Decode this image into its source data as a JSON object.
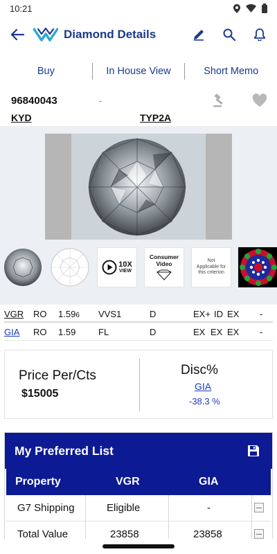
{
  "status": {
    "time": "10:21"
  },
  "app": {
    "title": "Diamond Details",
    "brand_color": "#1a3a8c"
  },
  "tabs": [
    {
      "label": "Buy"
    },
    {
      "label": "In House View"
    },
    {
      "label": "Short Memo"
    }
  ],
  "stone": {
    "stock_no": "96840043",
    "dash": "-",
    "code_left": "KYD",
    "code_right": "TYP2A"
  },
  "thumbs": {
    "consumer_video": "Consumer Video",
    "ten_x": "10X",
    "view": "VIEW",
    "not_applicable": "Not Applicable for this criterion"
  },
  "grading": [
    {
      "lab": "VGR",
      "shape": "RO",
      "carat": "1.59",
      "carat_suffix": "6",
      "clarity": "VVS1",
      "color": "D",
      "cut": "EX+",
      "polish": "ID",
      "symmetry": "EX",
      "fluor": "-"
    },
    {
      "lab": "GIA",
      "shape": "RO",
      "carat": "1.59",
      "carat_suffix": "",
      "clarity": "FL",
      "color": "D",
      "cut": "EX",
      "polish": "EX",
      "symmetry": "EX",
      "fluor": "-"
    }
  ],
  "price": {
    "label": "Price Per/Cts",
    "value": "$15005",
    "disc_label": "Disc%",
    "disc_lab": "GIA",
    "disc_value": "-38.3 %"
  },
  "preferred": {
    "title": "My Preferred List",
    "header_color": "#0c1a94",
    "columns": [
      "Property",
      "VGR",
      "GIA"
    ],
    "rows": [
      {
        "property": "G7 Shipping",
        "vgr": "Eligible",
        "gia": "-"
      },
      {
        "property": "Total Value",
        "vgr": "23858",
        "gia": "23858"
      }
    ]
  }
}
